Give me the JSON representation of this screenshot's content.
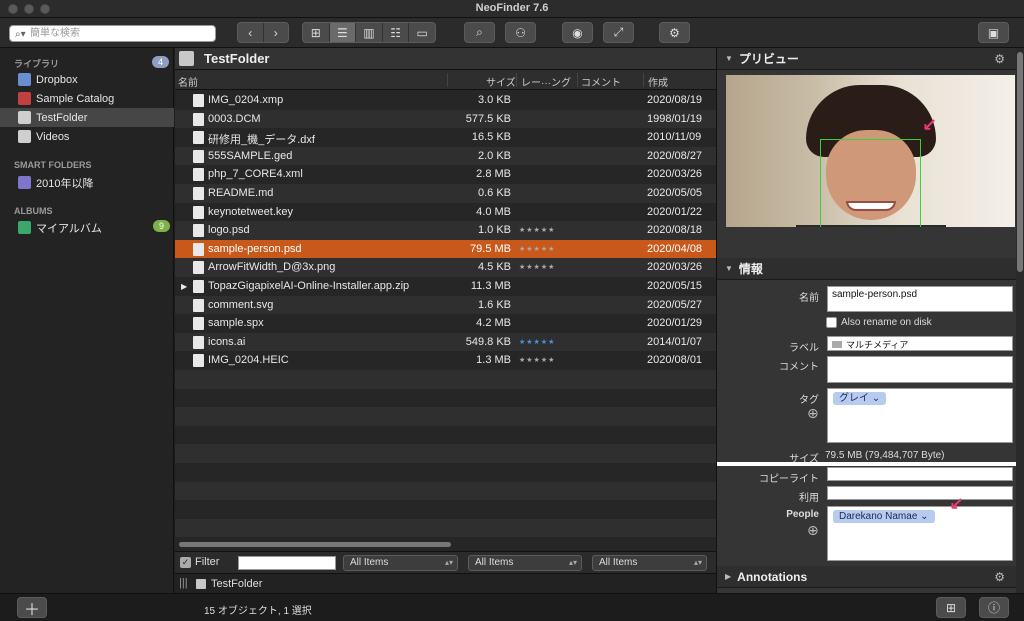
{
  "window": {
    "title": "NeoFinder 7.6"
  },
  "toolbar": {
    "search_placeholder": "簡単な検索"
  },
  "sidebar": {
    "library_header": "ライブラリ",
    "library_badge": "4",
    "items": [
      {
        "label": "Dropbox",
        "color": "#6a8fd0"
      },
      {
        "label": "Sample Catalog",
        "color": "#c24040"
      },
      {
        "label": "TestFolder",
        "color": "#cfcfcf"
      },
      {
        "label": "Videos",
        "color": "#cfcfcf"
      }
    ],
    "smart_header": "SMART FOLDERS",
    "smart_items": [
      {
        "label": "2010年以降",
        "color": "#7d76c9"
      }
    ],
    "albums_header": "ALBUMS",
    "albums": [
      {
        "label": "マイアルバム",
        "badge": "9",
        "color": "#3aa86a"
      }
    ]
  },
  "filelist": {
    "folder_title": "TestFolder",
    "columns": {
      "name": "名前",
      "size": "サイズ",
      "rating": "レー···ング",
      "comment": "コメント",
      "created": "作成"
    },
    "rows": [
      {
        "name": "IMG_0204.xmp",
        "size": "3.0 KB",
        "rating": "",
        "date": "2020/08/19"
      },
      {
        "name": "0003.DCM",
        "size": "577.5 KB",
        "rating": "",
        "date": "1998/01/19"
      },
      {
        "name": "研修用_機_データ.dxf",
        "size": "16.5 KB",
        "rating": "",
        "date": "2010/11/09"
      },
      {
        "name": "555SAMPLE.ged",
        "size": "2.0 KB",
        "rating": "",
        "date": "2020/08/27"
      },
      {
        "name": "php_7_CORE4.xml",
        "size": "2.8 MB",
        "rating": "",
        "date": "2020/03/26"
      },
      {
        "name": "README.md",
        "size": "0.6 KB",
        "rating": "",
        "date": "2020/05/05"
      },
      {
        "name": "keynotetweet.key",
        "size": "4.0 MB",
        "rating": "",
        "date": "2020/01/22"
      },
      {
        "name": "logo.psd",
        "size": "1.0 KB",
        "rating": "★★★★★",
        "date": "2020/08/18"
      },
      {
        "name": "sample-person.psd",
        "size": "79.5 MB",
        "rating": "★★★★★",
        "date": "2020/04/08",
        "selected": true
      },
      {
        "name": "ArrowFitWidth_D@3x.png",
        "size": "4.5 KB",
        "rating": "★★★★★",
        "date": "2020/03/26"
      },
      {
        "name": "TopazGigapixelAI-Online-Installer.app.zip",
        "size": "11.3 MB",
        "rating": "",
        "date": "2020/05/15"
      },
      {
        "name": "comment.svg",
        "size": "1.6 KB",
        "rating": "",
        "date": "2020/05/27"
      },
      {
        "name": "sample.spx",
        "size": "4.2 MB",
        "rating": "",
        "date": "2020/01/29"
      },
      {
        "name": "icons.ai",
        "size": "549.8 KB",
        "rating": "★★★★★",
        "date": "2014/01/07"
      },
      {
        "name": "IMG_0204.HEIC",
        "size": "1.3 MB",
        "rating": "★★★★★",
        "date": "2020/08/01"
      }
    ],
    "filter_label": "Filter",
    "filter_dropdowns": [
      "All Items",
      "All Items",
      "All Items"
    ],
    "path": "TestFolder"
  },
  "preview": {
    "header": "プリビュー"
  },
  "info": {
    "header": "情報",
    "name_label": "名前",
    "name_value": "sample-person.psd",
    "also_rename": "Also rename on disk",
    "label_label": "ラベル",
    "label_value": "マルチメディア",
    "comment_label": "コメント",
    "tag_label": "タグ",
    "tag_value": "グレイ",
    "size_label": "サイズ",
    "size_value": "79.5 MB (79,484,707 Byte)",
    "copyright_label": "コピーライト",
    "usage_label": "利用",
    "people_label": "People",
    "people_value": "Darekano Namae"
  },
  "annotations": {
    "header": "Annotations"
  },
  "status": {
    "text": "15 オブジェクト, 1 選択"
  }
}
